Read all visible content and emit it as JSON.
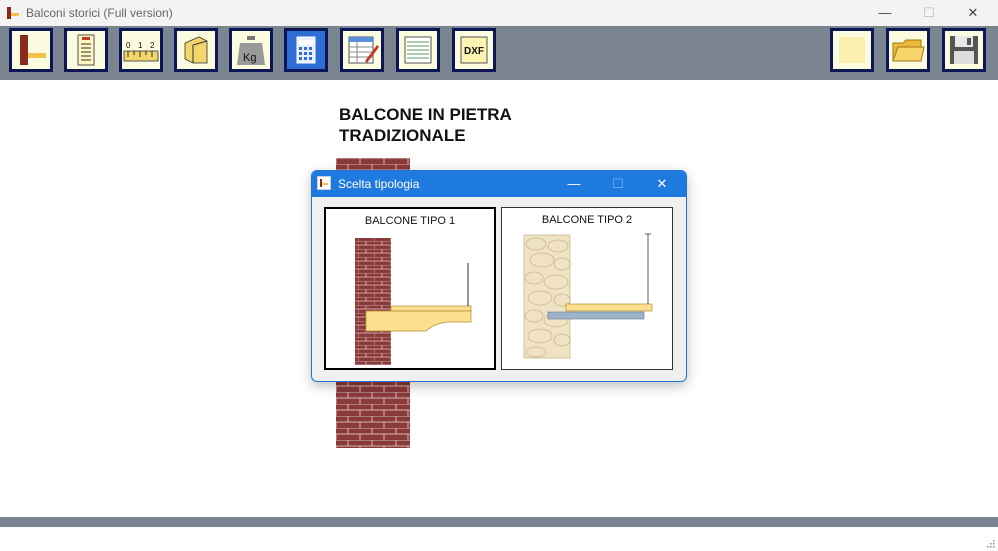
{
  "window": {
    "title": "Balconi storici (Full version)"
  },
  "toolbar": {
    "left_buttons": [
      "balcony-icon",
      "report-icon",
      "ruler-icon",
      "beam-icon",
      "weight-icon",
      "calculator-icon",
      "table-edit-icon",
      "sheet-icon",
      "dxf-icon"
    ],
    "dxf_label": "DXF",
    "weight_label": "Kg",
    "ruler_labels": [
      "0",
      "1",
      "2"
    ],
    "right_buttons": [
      "new-icon",
      "open-folder-icon",
      "save-icon"
    ]
  },
  "canvas": {
    "heading_line1": "BALCONE IN PIETRA",
    "heading_line2": "TRADIZIONALE"
  },
  "dialog": {
    "title": "Scelta tipologia",
    "options": [
      {
        "caption": "BALCONE TIPO 1",
        "selected": true
      },
      {
        "caption": "BALCONE TIPO 2",
        "selected": false
      }
    ]
  },
  "colors": {
    "toolbar": "#7b8592",
    "button_border": "#0c1654",
    "brick": "#8b3a3a",
    "stone": "#efe3c4",
    "slab": "#fde08f",
    "dialog_title": "#1f7ae0"
  }
}
